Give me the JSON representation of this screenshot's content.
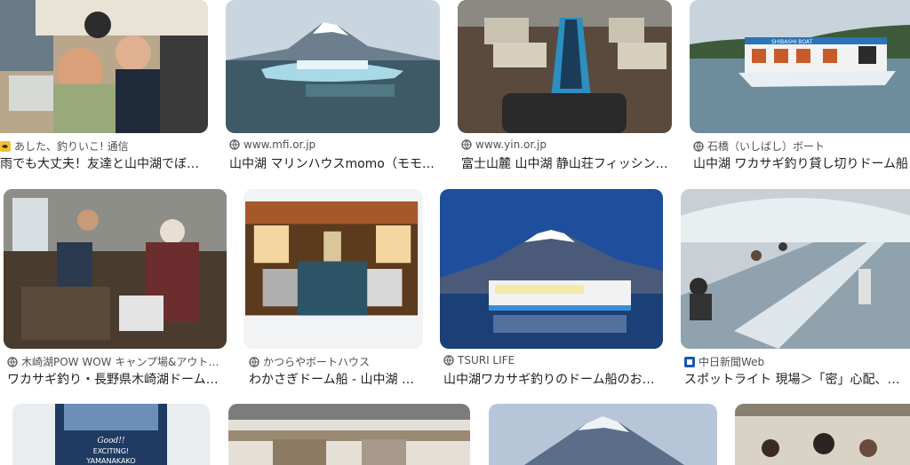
{
  "results": [
    {
      "source": "あした、釣りいこ! 通信",
      "title": "雨でも大丈夫！友達と山中湖でぼ…",
      "favicon": "fish-icon"
    },
    {
      "source": "www.mfi.or.jp",
      "title": "山中湖 マリンハウスmomo（モモ…",
      "favicon": "globe-icon"
    },
    {
      "source": "www.yin.or.jp",
      "title": "富士山麓 山中湖 静山荘フィッシン…",
      "favicon": "globe-icon"
    },
    {
      "source": "石橋（いしばし）ボート",
      "title": "山中湖 ワカサギ釣り貸し切りドーム船",
      "favicon": "globe-icon"
    },
    {
      "source": "木崎湖POW WOW キャンプ場&アウト…",
      "title": "ワカサギ釣り・長野県木崎湖ドーム…",
      "favicon": "globe-icon"
    },
    {
      "source": "かつらやボートハウス",
      "title": "わかさぎドーム船 - 山中湖 …",
      "favicon": "globe-icon"
    },
    {
      "source": "TSURI LIFE",
      "title": "山中湖ワカサギ釣りのドーム船のお…",
      "favicon": "globe-icon"
    },
    {
      "source": "中日新聞Web",
      "title": "スポットライト 現場＞「密」心配、伸び",
      "favicon": "chunichi-icon"
    }
  ],
  "row3_signs": {
    "line1": "Good!!",
    "line2": "EXCITING!",
    "line3": "YAMANAKAKO"
  },
  "boat_sign": "SHIBASHI BOAT"
}
